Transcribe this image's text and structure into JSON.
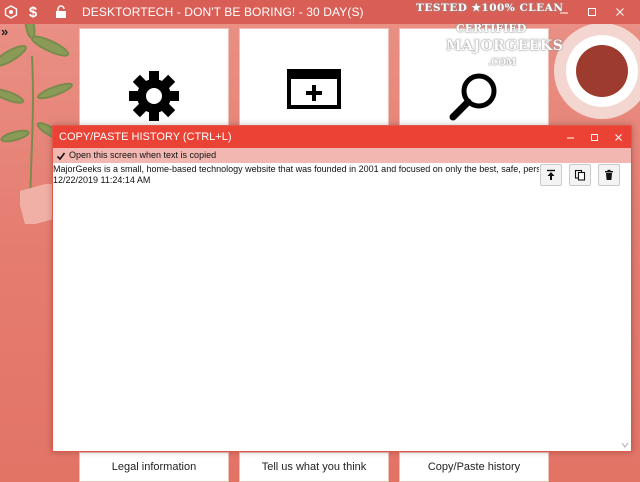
{
  "titlebar": {
    "title": "DESKTORTECH - DON'T BE BORING! - 30 DAY(S)",
    "icons": [
      "settings-hex-icon",
      "dollar-icon",
      "unlock-icon"
    ]
  },
  "window_controls": [
    "minimize-icon",
    "maximize-icon",
    "close-icon"
  ],
  "tiles": [
    {
      "name": "settings",
      "icon": "gear-icon"
    },
    {
      "name": "add-window",
      "icon": "add-window-icon"
    },
    {
      "name": "search",
      "icon": "magnifier-icon"
    }
  ],
  "bottom_buttons": {
    "legal": "Legal information",
    "feedback": "Tell us what you think",
    "history": "Copy/Paste history"
  },
  "dialog": {
    "title": "COPY/PASTE HISTORY (CTRL+L)",
    "option_label": "Open this screen when text is copied",
    "option_checked": true,
    "entries": [
      {
        "text": "MajorGeeks is a small, home-based technology website that was founded in 2001 and focused on only the best, safe, personally",
        "timestamp": "12/22/2019 11:24:14 AM"
      }
    ],
    "actions": [
      "pin-top-icon",
      "copy-icon",
      "trash-icon"
    ]
  },
  "watermark": {
    "line1": "TESTED ★100% CLEAN",
    "line2": "CERTIFIED",
    "line3": "MAJORGEEKS",
    "line4": ".COM"
  },
  "colors": {
    "titlebar": "#d95f56",
    "dialog_titlebar": "#ea4335",
    "option_bar": "#f2b7b0",
    "background": "#e8837a"
  }
}
